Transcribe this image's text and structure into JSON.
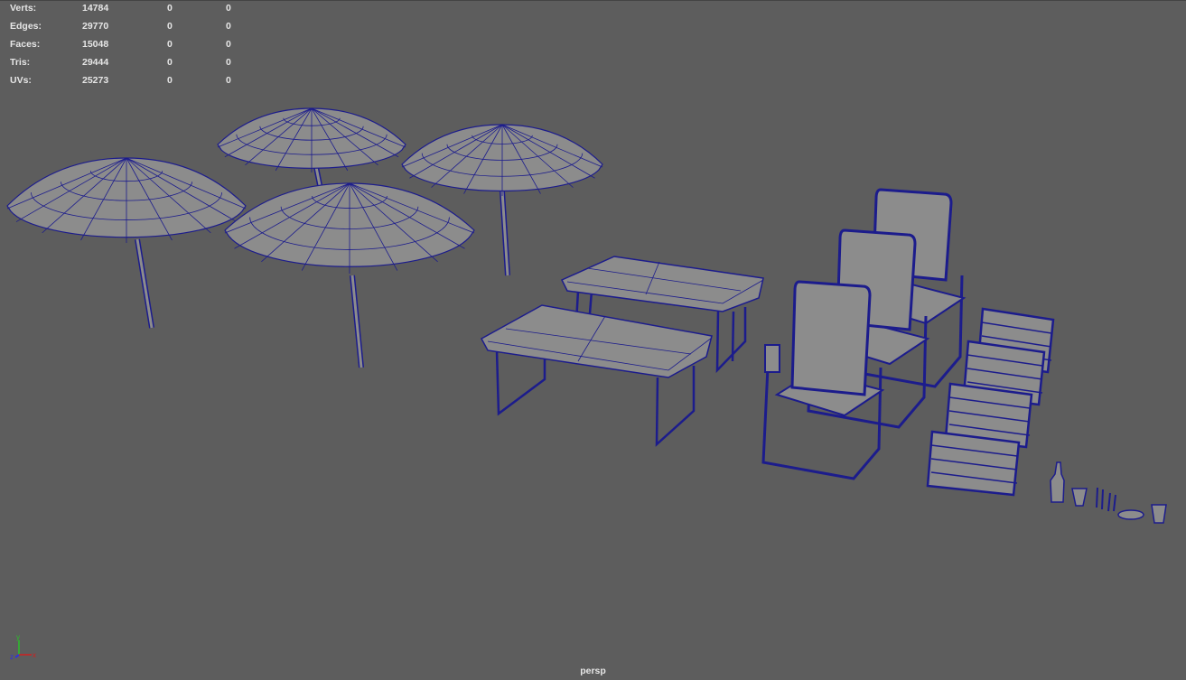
{
  "hud": {
    "rows": [
      {
        "label": "Verts:",
        "v1": "14784",
        "v2": "0",
        "v3": "0"
      },
      {
        "label": "Edges:",
        "v1": "29770",
        "v2": "0",
        "v3": "0"
      },
      {
        "label": "Faces:",
        "v1": "15048",
        "v2": "0",
        "v3": "0"
      },
      {
        "label": "Tris:",
        "v1": "29444",
        "v2": "0",
        "v3": "0"
      },
      {
        "label": "UVs:",
        "v1": "25273",
        "v2": "0",
        "v3": "0"
      }
    ]
  },
  "camera_label": "persp",
  "axis": {
    "x": "x",
    "y": "y",
    "z": "z"
  },
  "colors": {
    "background": "#5d5d5d",
    "mesh": "#8c8c8c",
    "wire": "#1c1c8c"
  }
}
